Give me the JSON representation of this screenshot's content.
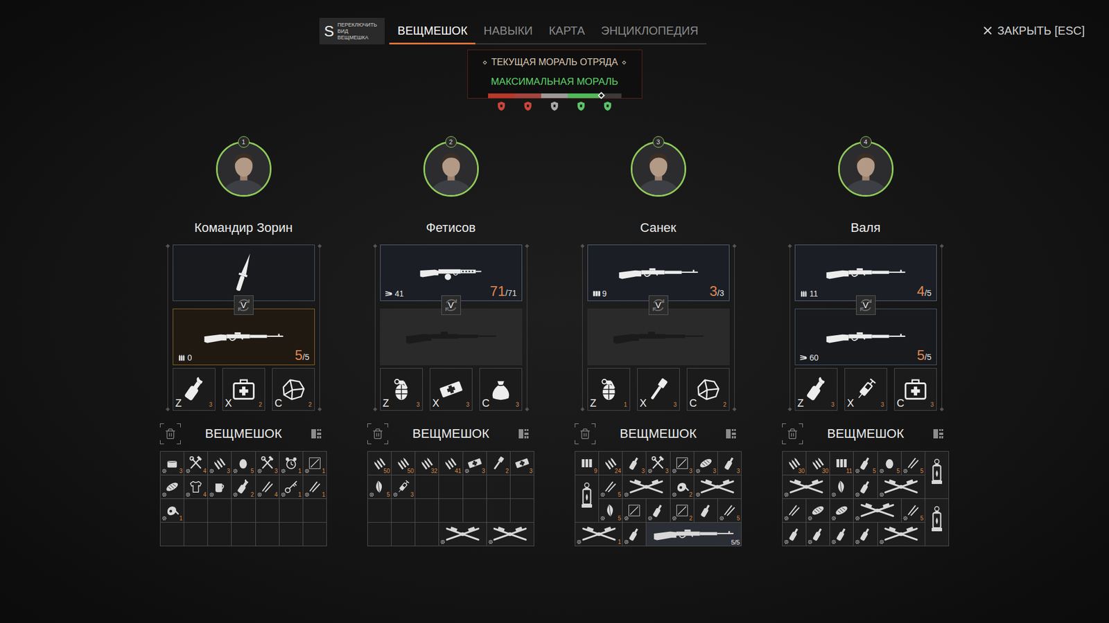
{
  "view_switch": {
    "key": "S",
    "label": "ПЕРЕКЛЮЧИТЬ ВИД ВЕЩМЕШКА"
  },
  "tabs": [
    {
      "label": "ВЕЩМЕШОК",
      "selected": true
    },
    {
      "label": "НАВЫКИ",
      "selected": false
    },
    {
      "label": "КАРТА",
      "selected": false
    },
    {
      "label": "ЭНЦИКЛОПЕДИЯ",
      "selected": false
    }
  ],
  "close": {
    "label": "ЗАКРЫТЬ [ESC]"
  },
  "morale": {
    "title": "ТЕКУЩАЯ МОРАЛЬ ОТРЯДА",
    "status": "МАКСИМАЛЬНАЯ МОРАЛЬ",
    "level": 0.85,
    "segments": [
      {
        "color": "#b8382a",
        "icon_color": "#c9463a"
      },
      {
        "color": "#a5443d",
        "icon_color": "#c9463a"
      },
      {
        "color": "#9a9a9a",
        "icon_color": "#a8a8a8"
      },
      {
        "color": "#4fb85a",
        "icon_color": "#5cc468"
      },
      {
        "color": "#4fb85a",
        "icon_color": "#5cc468"
      }
    ]
  },
  "swap_key": "V",
  "squad": [
    {
      "number": "1",
      "name": "Командир Зорин",
      "backpack_title": "ВЕЩМЕШОК",
      "weapons": [
        {
          "kind": "knife",
          "active": false,
          "focused": false
        },
        {
          "kind": "rifle",
          "active": true,
          "focused": true,
          "ammo_kind": "clip",
          "ammo": "0",
          "loaded": "5",
          "capacity": "/5"
        }
      ],
      "quick": [
        {
          "key": "Z",
          "kind": "molotov",
          "count": "3"
        },
        {
          "key": "X",
          "kind": "medkit",
          "count": "2"
        },
        {
          "key": "C",
          "kind": "cloth",
          "count": "2"
        }
      ],
      "backpack": [
        {
          "kind": "can",
          "count": "3",
          "gear": true,
          "cell": [
            1,
            1
          ],
          "size": [
            1,
            1
          ]
        },
        {
          "kind": "tools",
          "count": "4",
          "gear": true,
          "cell": [
            2,
            1
          ],
          "size": [
            1,
            1
          ]
        },
        {
          "kind": "cartridges",
          "count": "3",
          "gear": true,
          "cell": [
            3,
            1
          ],
          "size": [
            1,
            1
          ]
        },
        {
          "kind": "egg",
          "count": "5",
          "gear": true,
          "cell": [
            4,
            1
          ],
          "size": [
            1,
            1
          ]
        },
        {
          "kind": "tools",
          "count": "3",
          "gear": true,
          "cell": [
            5,
            1
          ],
          "size": [
            1,
            1
          ]
        },
        {
          "kind": "clock",
          "count": "1",
          "gear": true,
          "cell": [
            6,
            1
          ],
          "size": [
            1,
            1
          ]
        },
        {
          "kind": "scrap",
          "count": "1",
          "gear": true,
          "cell": [
            7,
            1
          ],
          "size": [
            1,
            1
          ]
        },
        {
          "kind": "bread",
          "gear": true,
          "cell": [
            1,
            2
          ],
          "size": [
            1,
            1
          ]
        },
        {
          "kind": "shirt",
          "count": "4",
          "gear": true,
          "cell": [
            2,
            2
          ],
          "size": [
            1,
            1
          ]
        },
        {
          "kind": "cup",
          "gear": true,
          "cell": [
            3,
            2
          ],
          "size": [
            1,
            1
          ]
        },
        {
          "kind": "molotov",
          "count": "2",
          "gear": true,
          "cell": [
            4,
            2
          ],
          "size": [
            1,
            1
          ]
        },
        {
          "kind": "sticks",
          "count": "4",
          "gear": true,
          "cell": [
            5,
            2
          ],
          "size": [
            1,
            1
          ]
        },
        {
          "kind": "key",
          "count": "1",
          "gear": true,
          "cell": [
            6,
            2
          ],
          "size": [
            1,
            1
          ]
        },
        {
          "kind": "sticks",
          "count": "1",
          "gear": true,
          "cell": [
            7,
            2
          ],
          "size": [
            1,
            1
          ]
        },
        {
          "kind": "meat",
          "count": "1",
          "gear": true,
          "cell": [
            1,
            3
          ],
          "size": [
            1,
            1
          ]
        }
      ]
    },
    {
      "number": "2",
      "name": "Фетисов",
      "backpack_title": "ВЕЩМЕШОК",
      "weapons": [
        {
          "kind": "smg",
          "active": true,
          "focused": false,
          "ammo_kind": "spread",
          "ammo": "41",
          "loaded": "71",
          "capacity": "/71"
        },
        {
          "kind": "empty",
          "active": false,
          "focused": false
        }
      ],
      "quick": [
        {
          "key": "Z",
          "kind": "grenade",
          "count": "3"
        },
        {
          "key": "X",
          "kind": "bandage",
          "count": "3"
        },
        {
          "key": "C",
          "kind": "bag",
          "count": "3"
        }
      ],
      "backpack": [
        {
          "kind": "cartridges",
          "count": "50",
          "gear": false,
          "cell": [
            1,
            1
          ],
          "size": [
            1,
            1
          ]
        },
        {
          "kind": "cartridges",
          "count": "50",
          "gear": false,
          "cell": [
            2,
            1
          ],
          "size": [
            1,
            1
          ]
        },
        {
          "kind": "cartridges",
          "count": "32",
          "gear": false,
          "cell": [
            3,
            1
          ],
          "size": [
            1,
            1
          ]
        },
        {
          "kind": "cartridges",
          "count": "41",
          "gear": false,
          "cell": [
            4,
            1
          ],
          "size": [
            1,
            1
          ]
        },
        {
          "kind": "bandage",
          "count": "3",
          "gear": true,
          "cell": [
            5,
            1
          ],
          "size": [
            1,
            1
          ]
        },
        {
          "kind": "stick-grenade",
          "count": "2",
          "gear": false,
          "cell": [
            6,
            1
          ],
          "size": [
            1,
            1
          ]
        },
        {
          "kind": "bandage",
          "count": "3",
          "gear": false,
          "cell": [
            7,
            1
          ],
          "size": [
            1,
            1
          ]
        },
        {
          "kind": "leaf",
          "count": "5",
          "gear": true,
          "cell": [
            1,
            2
          ],
          "size": [
            1,
            1
          ]
        },
        {
          "kind": "syringe",
          "count": "3",
          "gear": true,
          "cell": [
            2,
            2
          ],
          "size": [
            1,
            1
          ]
        },
        {
          "kind": "parts",
          "gear": true,
          "cell": [
            4,
            4
          ],
          "size": [
            2,
            1
          ]
        },
        {
          "kind": "parts",
          "gear": true,
          "cell": [
            6,
            4
          ],
          "size": [
            2,
            1
          ]
        }
      ]
    },
    {
      "number": "3",
      "name": "Санек",
      "backpack_title": "ВЕЩМЕШОК",
      "weapons": [
        {
          "kind": "rifle",
          "active": true,
          "focused": false,
          "ammo_kind": "box",
          "ammo": "9",
          "loaded": "3",
          "capacity": "/3"
        },
        {
          "kind": "empty",
          "active": false,
          "focused": false
        }
      ],
      "quick": [
        {
          "key": "Z",
          "kind": "grenade",
          "count": "1"
        },
        {
          "key": "X",
          "kind": "stick-grenade",
          "count": "3"
        },
        {
          "key": "C",
          "kind": "cloth",
          "count": "2"
        }
      ],
      "backpack": [
        {
          "kind": "ammo-box",
          "count": "9",
          "gear": false,
          "cell": [
            1,
            1
          ],
          "size": [
            1,
            1
          ]
        },
        {
          "kind": "cartridges",
          "count": "24",
          "gear": false,
          "cell": [
            2,
            1
          ],
          "size": [
            1,
            1
          ]
        },
        {
          "kind": "bottle",
          "count": "3",
          "gear": false,
          "cell": [
            3,
            1
          ],
          "size": [
            1,
            1
          ]
        },
        {
          "kind": "tools",
          "count": "3",
          "gear": true,
          "cell": [
            4,
            1
          ],
          "size": [
            1,
            1
          ]
        },
        {
          "kind": "scrap",
          "count": "3",
          "gear": true,
          "cell": [
            5,
            1
          ],
          "size": [
            1,
            1
          ]
        },
        {
          "kind": "bread",
          "count": "3",
          "gear": true,
          "cell": [
            6,
            1
          ],
          "size": [
            1,
            1
          ]
        },
        {
          "kind": "bottle",
          "count": "3",
          "gear": false,
          "cell": [
            7,
            1
          ],
          "size": [
            1,
            1
          ]
        },
        {
          "kind": "lantern",
          "gear": false,
          "cell": [
            1,
            2
          ],
          "size": [
            1,
            2
          ]
        },
        {
          "kind": "sticks",
          "count": "5",
          "gear": true,
          "cell": [
            2,
            2
          ],
          "size": [
            1,
            1
          ]
        },
        {
          "kind": "parts",
          "gear": true,
          "cell": [
            3,
            2
          ],
          "size": [
            2,
            1
          ]
        },
        {
          "kind": "meat",
          "count": "2",
          "gear": true,
          "cell": [
            5,
            2
          ],
          "size": [
            1,
            1
          ]
        },
        {
          "kind": "parts",
          "gear": true,
          "cell": [
            6,
            2
          ],
          "size": [
            2,
            1
          ]
        },
        {
          "kind": "leaf",
          "count": "5",
          "gear": true,
          "cell": [
            2,
            3
          ],
          "size": [
            1,
            1
          ]
        },
        {
          "kind": "scrap",
          "gear": true,
          "cell": [
            3,
            3
          ],
          "size": [
            1,
            1
          ]
        },
        {
          "kind": "bottle",
          "gear": true,
          "cell": [
            4,
            3
          ],
          "size": [
            1,
            1
          ]
        },
        {
          "kind": "scrap",
          "count": "2",
          "gear": true,
          "cell": [
            5,
            3
          ],
          "size": [
            1,
            1
          ]
        },
        {
          "kind": "bottle",
          "gear": false,
          "cell": [
            6,
            3
          ],
          "size": [
            1,
            1
          ]
        },
        {
          "kind": "sticks",
          "count": "5",
          "gear": true,
          "cell": [
            7,
            3
          ],
          "size": [
            1,
            1
          ]
        },
        {
          "kind": "parts",
          "count": "1",
          "gear": true,
          "cell": [
            1,
            4
          ],
          "size": [
            2,
            1
          ]
        },
        {
          "kind": "bottle",
          "gear": true,
          "cell": [
            3,
            4
          ],
          "size": [
            1,
            1
          ]
        },
        {
          "kind": "rifle",
          "count": "5/5",
          "gear": false,
          "cell": [
            4,
            4
          ],
          "size": [
            4,
            1
          ]
        }
      ]
    },
    {
      "number": "4",
      "name": "Валя",
      "backpack_title": "ВЕЩМЕШОК",
      "weapons": [
        {
          "kind": "rifle",
          "active": true,
          "focused": false,
          "ammo_kind": "clip",
          "ammo": "11",
          "loaded": "4",
          "capacity": "/5"
        },
        {
          "kind": "rifle",
          "active": false,
          "focused": false,
          "ammo_kind": "spread",
          "ammo": "60",
          "loaded": "5",
          "capacity": "/5"
        }
      ],
      "quick": [
        {
          "key": "Z",
          "kind": "molotov",
          "count": "3"
        },
        {
          "key": "X",
          "kind": "syringe",
          "count": "3"
        },
        {
          "key": "C",
          "kind": "medkit",
          "count": "3"
        }
      ],
      "backpack": [
        {
          "kind": "cartridges",
          "count": "30",
          "gear": false,
          "cell": [
            1,
            1
          ],
          "size": [
            1,
            1
          ]
        },
        {
          "kind": "cartridges",
          "count": "30",
          "gear": false,
          "cell": [
            2,
            1
          ],
          "size": [
            1,
            1
          ]
        },
        {
          "kind": "ammo-box",
          "count": "11",
          "gear": false,
          "cell": [
            3,
            1
          ],
          "size": [
            1,
            1
          ]
        },
        {
          "kind": "bottle",
          "count": "5",
          "gear": true,
          "cell": [
            4,
            1
          ],
          "size": [
            1,
            1
          ]
        },
        {
          "kind": "egg",
          "count": "5",
          "gear": true,
          "cell": [
            5,
            1
          ],
          "size": [
            1,
            1
          ]
        },
        {
          "kind": "sticks",
          "count": "5",
          "gear": true,
          "cell": [
            6,
            1
          ],
          "size": [
            1,
            1
          ]
        },
        {
          "kind": "lantern",
          "gear": false,
          "cell": [
            7,
            1
          ],
          "size": [
            1,
            2
          ]
        },
        {
          "kind": "parts",
          "gear": true,
          "cell": [
            1,
            2
          ],
          "size": [
            2,
            1
          ]
        },
        {
          "kind": "leaf",
          "gear": true,
          "cell": [
            3,
            2
          ],
          "size": [
            1,
            1
          ]
        },
        {
          "kind": "bottle",
          "gear": true,
          "cell": [
            4,
            2
          ],
          "size": [
            1,
            1
          ]
        },
        {
          "kind": "parts",
          "gear": true,
          "cell": [
            5,
            2
          ],
          "size": [
            2,
            1
          ]
        },
        {
          "kind": "sticks",
          "gear": true,
          "cell": [
            1,
            3
          ],
          "size": [
            1,
            1
          ]
        },
        {
          "kind": "bread",
          "gear": true,
          "cell": [
            2,
            3
          ],
          "size": [
            1,
            1
          ]
        },
        {
          "kind": "bread",
          "gear": true,
          "cell": [
            3,
            3
          ],
          "size": [
            1,
            1
          ]
        },
        {
          "kind": "parts",
          "gear": true,
          "cell": [
            4,
            3
          ],
          "size": [
            2,
            1
          ]
        },
        {
          "kind": "sticks",
          "count": "5",
          "gear": true,
          "cell": [
            6,
            3
          ],
          "size": [
            1,
            1
          ]
        },
        {
          "kind": "lantern",
          "gear": false,
          "cell": [
            7,
            3
          ],
          "size": [
            1,
            2
          ]
        },
        {
          "kind": "bottle",
          "gear": true,
          "cell": [
            1,
            4
          ],
          "size": [
            1,
            1
          ]
        },
        {
          "kind": "bottle",
          "gear": true,
          "cell": [
            2,
            4
          ],
          "size": [
            1,
            1
          ]
        },
        {
          "kind": "bottle",
          "gear": true,
          "cell": [
            3,
            4
          ],
          "size": [
            1,
            1
          ]
        },
        {
          "kind": "bottle",
          "gear": true,
          "cell": [
            4,
            4
          ],
          "size": [
            1,
            1
          ]
        },
        {
          "kind": "parts",
          "gear": true,
          "cell": [
            5,
            4
          ],
          "size": [
            2,
            1
          ]
        }
      ]
    }
  ]
}
